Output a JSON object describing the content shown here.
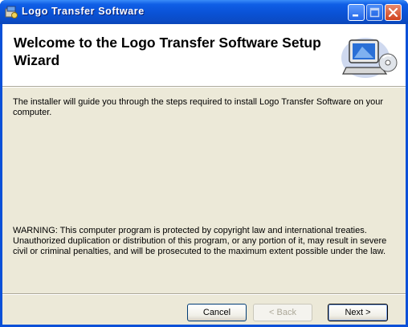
{
  "window": {
    "title": "Logo Transfer Software",
    "controls": {
      "minimize": "minimize-icon",
      "maximize": "maximize-icon",
      "close": "close-icon"
    }
  },
  "header": {
    "title": "Welcome to the Logo Transfer Software Setup Wizard",
    "art_icon": "computer-disc-icon"
  },
  "body": {
    "intro": "The installer will guide you through the steps required to install Logo Transfer Software on your computer.",
    "warning": "WARNING: This computer program is protected by copyright law and international treaties. Unauthorized duplication or distribution of this program, or any portion of it, may result in severe civil or criminal penalties, and will be prosecuted to the maximum extent possible under the law."
  },
  "buttons": {
    "cancel": "Cancel",
    "back": "< Back",
    "next": "Next >"
  },
  "colors": {
    "titlebar": "#0a52d6",
    "dialog_bg": "#ece9d8",
    "close_button": "#d0431f"
  }
}
